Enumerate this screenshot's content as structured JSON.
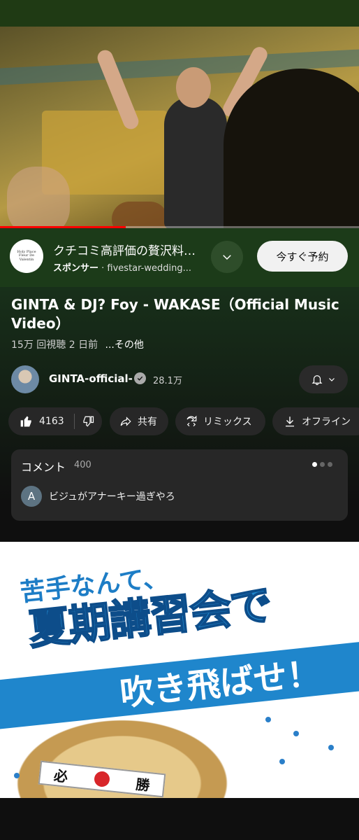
{
  "video": {
    "progress_fraction": 0.35
  },
  "ad": {
    "logo_text": "Holy Place Fleur De Valentin",
    "title": "クチコミ高評価の贅沢料…",
    "sponsor_label": "スポンサー",
    "sponsor_domain": "fivestar-wedding...",
    "cta_label": "今すぐ予約"
  },
  "info": {
    "title": "GINTA & DJ? Foy - WAKASE（Official Music Video）",
    "views": "15万 回視聴",
    "age": "2 日前",
    "more": "...その他"
  },
  "channel": {
    "name": "GINTA-official-",
    "subscribers": "28.1万"
  },
  "actions": {
    "like_count": "4163",
    "share": "共有",
    "remix": "リミックス",
    "offline": "オフライン"
  },
  "comments": {
    "title": "コメント",
    "count": "400",
    "top_author_initial": "A",
    "top_comment": "ビジュがアナーキー過ぎやろ"
  },
  "banner": {
    "line1": "苦手なんて、",
    "line2": "夏期講習会で",
    "line3": "吹き飛ばせ！",
    "band_left": "必",
    "band_right": "勝"
  },
  "colors": {
    "accent": "#ff0000",
    "ad_background": "#1c3b19",
    "banner_blue": "#1f86cc"
  }
}
